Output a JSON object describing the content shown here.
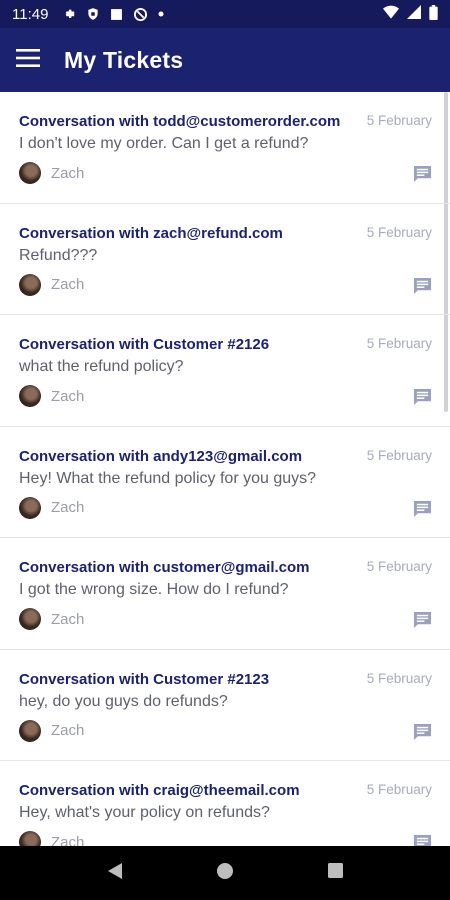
{
  "status_bar": {
    "time": "11:49",
    "left_icons": [
      "gear-icon",
      "shield-icon",
      "square-icon",
      "data-saver-icon",
      "dot-icon"
    ],
    "right_icons": [
      "wifi-icon",
      "signal-icon",
      "battery-icon"
    ]
  },
  "app_bar": {
    "title": "My Tickets",
    "menu_icon": "hamburger-menu-icon",
    "background": "#1b2270"
  },
  "tickets": [
    {
      "title": "Conversation with todd@customerorder.com",
      "date": "5 February",
      "message": "I don't love my order. Can I get a refund?",
      "agent": "Zach"
    },
    {
      "title": "Conversation with zach@refund.com",
      "date": "5 February",
      "message": "Refund???",
      "agent": "Zach"
    },
    {
      "title": "Conversation with Customer #2126",
      "date": "5 February",
      "message": "what the refund policy?",
      "agent": "Zach"
    },
    {
      "title": "Conversation with andy123@gmail.com",
      "date": "5 February",
      "message": "Hey! What the refund policy for you guys?",
      "agent": "Zach"
    },
    {
      "title": "Conversation with customer@gmail.com",
      "date": "5 February",
      "message": "I got the wrong size. How do I refund?",
      "agent": "Zach"
    },
    {
      "title": "Conversation with Customer #2123",
      "date": "5 February",
      "message": "hey, do you guys do refunds?",
      "agent": "Zach"
    },
    {
      "title": "Conversation with craig@theemail.com",
      "date": "5 February",
      "message": "Hey, what's your policy on refunds?",
      "agent": "Zach"
    }
  ],
  "nav_bar": {
    "buttons": [
      "back-icon",
      "home-icon",
      "recents-icon"
    ]
  }
}
